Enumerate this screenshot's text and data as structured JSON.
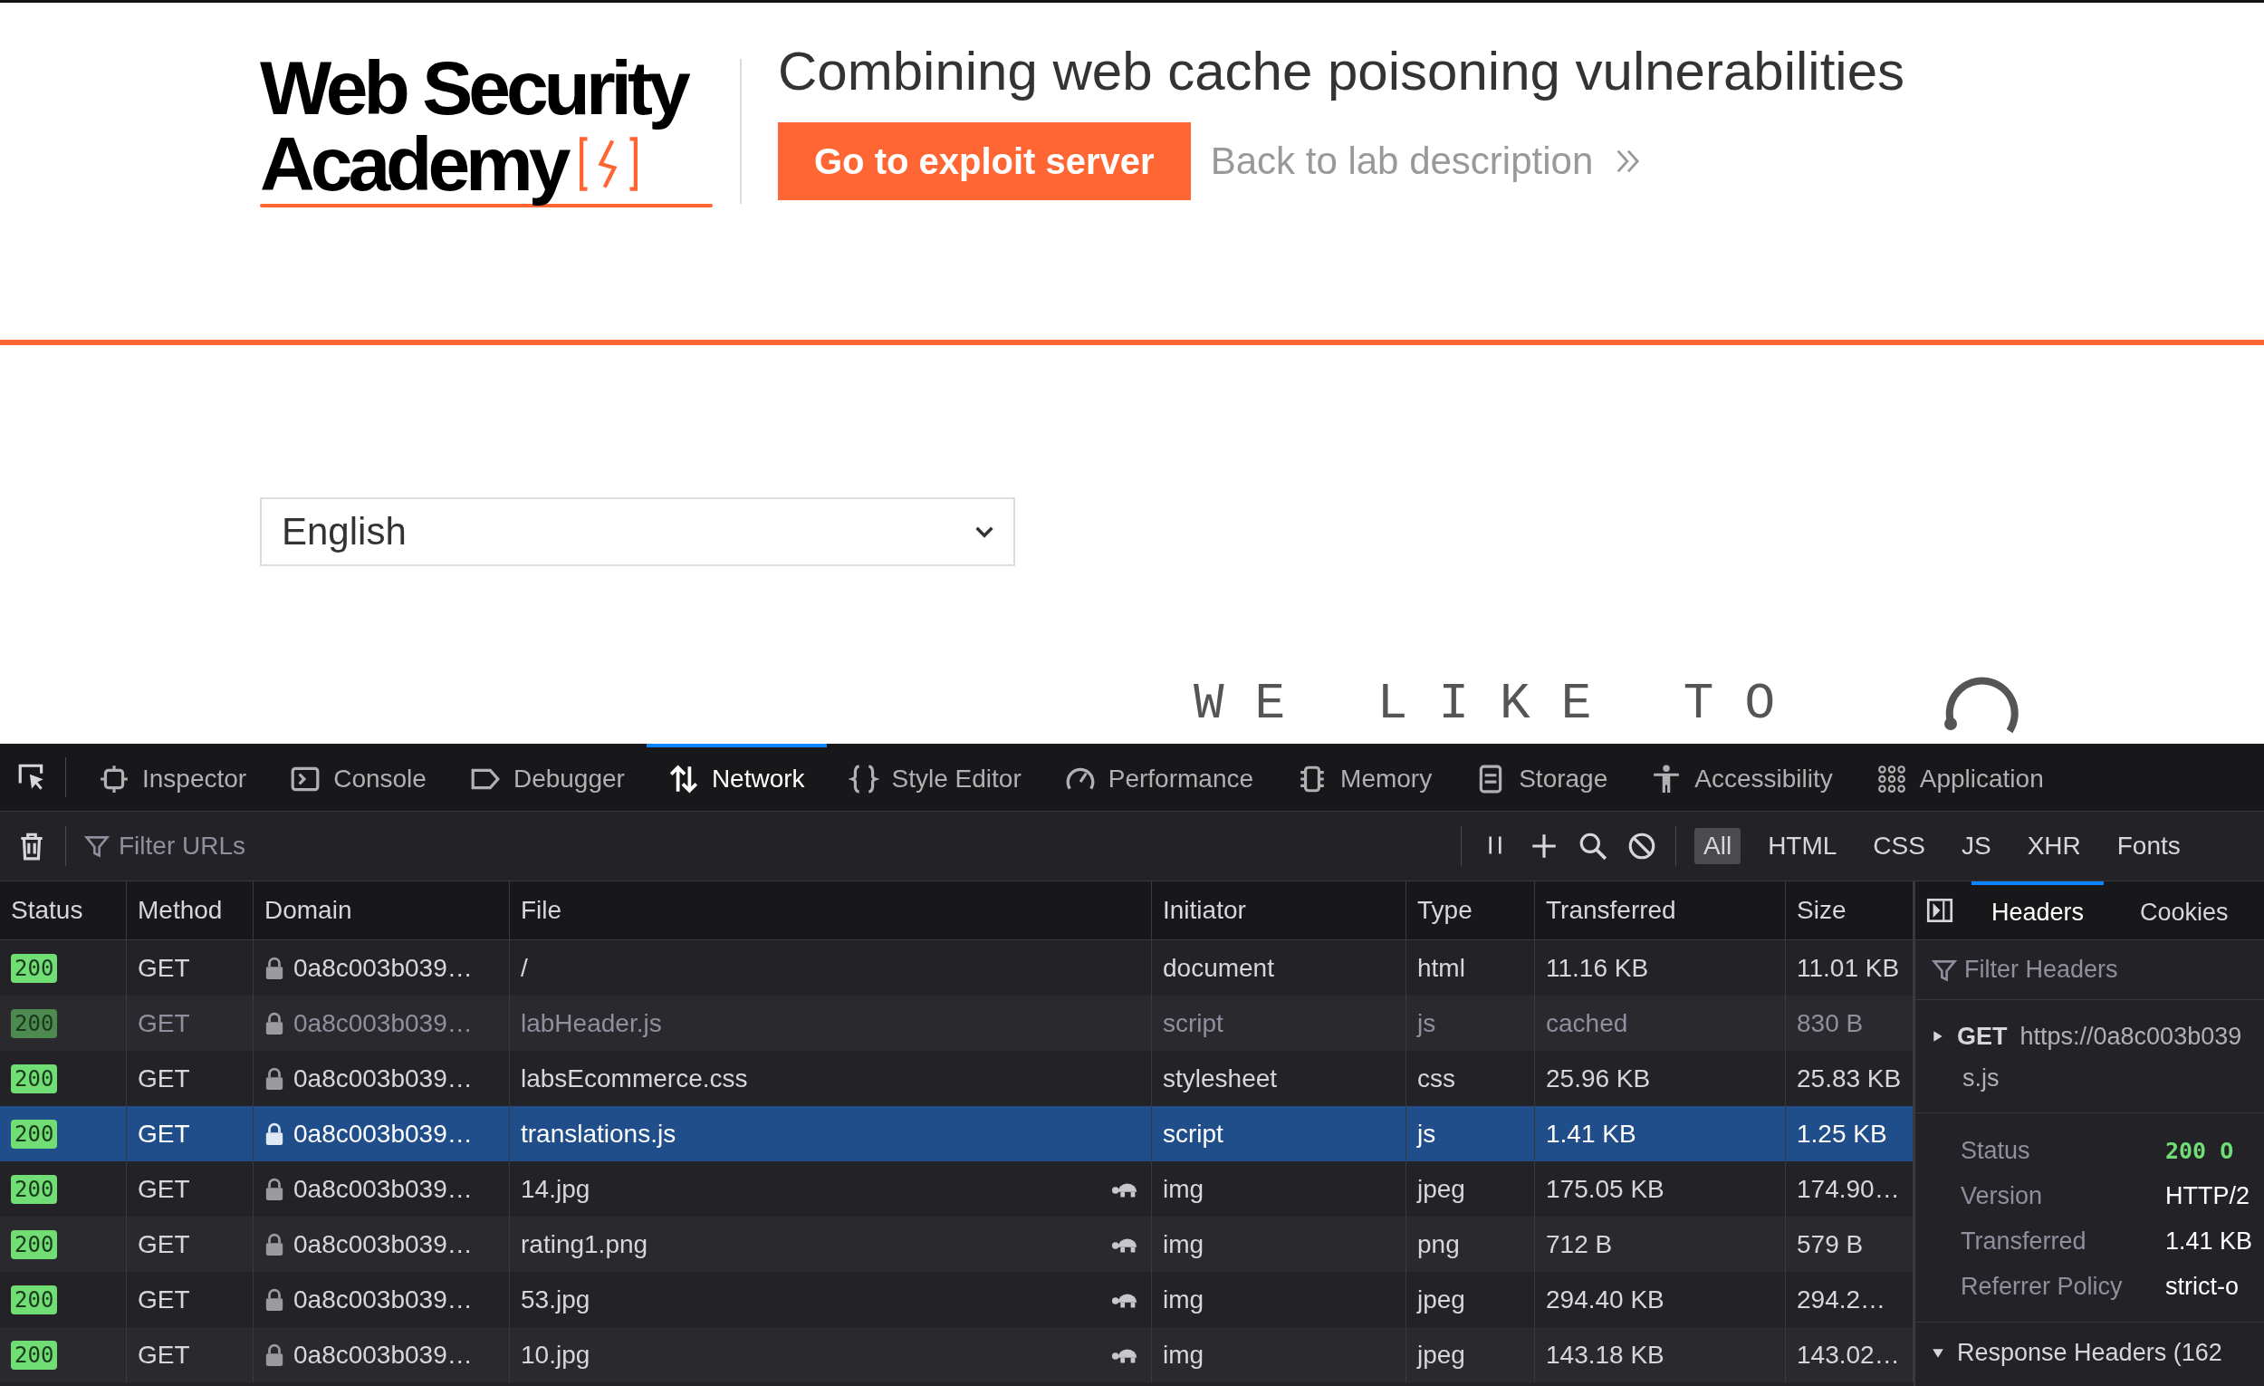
{
  "header": {
    "logo_lines": [
      "Web Security",
      "Academy"
    ],
    "title": "Combining web cache poisoning vulnerabilities",
    "exploit_button": "Go to exploit server",
    "back_link": "Back to lab description"
  },
  "language_select": {
    "value": "English"
  },
  "banner_text": "WE LIKE TO",
  "devtools": {
    "tabs": [
      {
        "label": "Inspector",
        "kind": "inspector",
        "selected": false
      },
      {
        "label": "Console",
        "kind": "console",
        "selected": false
      },
      {
        "label": "Debugger",
        "kind": "debugger",
        "selected": false
      },
      {
        "label": "Network",
        "kind": "network",
        "selected": true
      },
      {
        "label": "Style Editor",
        "kind": "style",
        "selected": false
      },
      {
        "label": "Performance",
        "kind": "performance",
        "selected": false
      },
      {
        "label": "Memory",
        "kind": "memory",
        "selected": false
      },
      {
        "label": "Storage",
        "kind": "storage",
        "selected": false
      },
      {
        "label": "Accessibility",
        "kind": "accessibility",
        "selected": false
      },
      {
        "label": "Application",
        "kind": "application",
        "selected": false
      }
    ],
    "filter": {
      "placeholder": "Filter URLs"
    },
    "type_filters": [
      {
        "label": "All",
        "selected": true
      },
      {
        "label": "HTML",
        "selected": false
      },
      {
        "label": "CSS",
        "selected": false
      },
      {
        "label": "JS",
        "selected": false
      },
      {
        "label": "XHR",
        "selected": false
      },
      {
        "label": "Fonts",
        "selected": false
      }
    ],
    "table": {
      "columns": [
        "Status",
        "Method",
        "Domain",
        "File",
        "Initiator",
        "Type",
        "Transferred",
        "Size"
      ],
      "rows": [
        {
          "status": "200",
          "method": "GET",
          "domain": "0a8c003b039…",
          "file": "/",
          "slow": false,
          "initiator": "document",
          "type": "html",
          "transferred": "11.16 KB",
          "size": "11.01 KB",
          "cached": false,
          "selected": false
        },
        {
          "status": "200",
          "method": "GET",
          "domain": "0a8c003b039…",
          "file": "labHeader.js",
          "slow": false,
          "initiator": "script",
          "type": "js",
          "transferred": "cached",
          "size": "830 B",
          "cached": true,
          "selected": false
        },
        {
          "status": "200",
          "method": "GET",
          "domain": "0a8c003b039…",
          "file": "labsEcommerce.css",
          "slow": false,
          "initiator": "stylesheet",
          "type": "css",
          "transferred": "25.96 KB",
          "size": "25.83 KB",
          "cached": false,
          "selected": false
        },
        {
          "status": "200",
          "method": "GET",
          "domain": "0a8c003b039…",
          "file": "translations.js",
          "slow": false,
          "initiator": "script",
          "type": "js",
          "transferred": "1.41 KB",
          "size": "1.25 KB",
          "cached": false,
          "selected": true
        },
        {
          "status": "200",
          "method": "GET",
          "domain": "0a8c003b039…",
          "file": "14.jpg",
          "slow": true,
          "initiator": "img",
          "type": "jpeg",
          "transferred": "175.05 KB",
          "size": "174.90…",
          "cached": false,
          "selected": false
        },
        {
          "status": "200",
          "method": "GET",
          "domain": "0a8c003b039…",
          "file": "rating1.png",
          "slow": true,
          "initiator": "img",
          "type": "png",
          "transferred": "712 B",
          "size": "579 B",
          "cached": false,
          "selected": false
        },
        {
          "status": "200",
          "method": "GET",
          "domain": "0a8c003b039…",
          "file": "53.jpg",
          "slow": true,
          "initiator": "img",
          "type": "jpeg",
          "transferred": "294.40 KB",
          "size": "294.2…",
          "cached": false,
          "selected": false
        },
        {
          "status": "200",
          "method": "GET",
          "domain": "0a8c003b039…",
          "file": "10.jpg",
          "slow": true,
          "initiator": "img",
          "type": "jpeg",
          "transferred": "143.18 KB",
          "size": "143.02…",
          "cached": false,
          "selected": false
        }
      ]
    }
  },
  "sidebar": {
    "tabs": [
      {
        "label": "Headers",
        "selected": true
      },
      {
        "label": "Cookies",
        "selected": false
      }
    ],
    "filter": {
      "placeholder": "Filter Headers"
    },
    "request": {
      "method": "GET",
      "url": "https://0a8c003b039",
      "url_continued": "s.js",
      "expanded": false
    },
    "fields": [
      {
        "label": "Status",
        "value": "200 O",
        "kind": "status"
      },
      {
        "label": "Version",
        "value": "HTTP/2",
        "kind": "text"
      },
      {
        "label": "Transferred",
        "value": "1.41 KB",
        "kind": "text"
      },
      {
        "label": "Referrer Policy",
        "value": "strict-o",
        "kind": "text"
      }
    ],
    "section": {
      "label": "Response Headers (162",
      "expanded": true
    }
  }
}
